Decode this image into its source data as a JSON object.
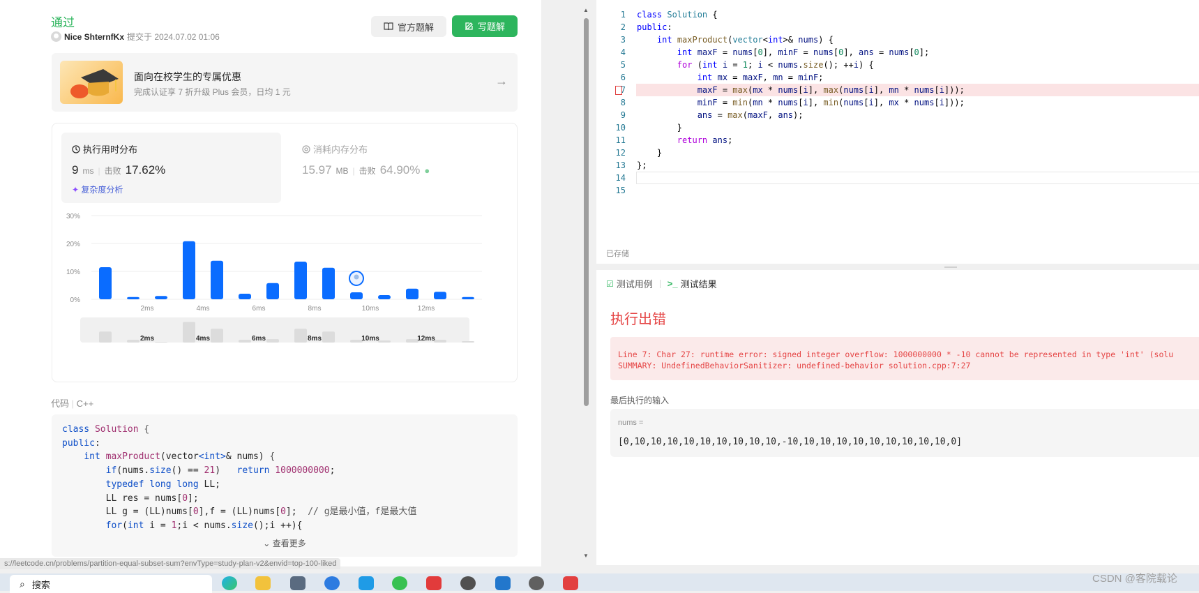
{
  "submission": {
    "status": "通过",
    "user": "Nice ShternfKx",
    "submitted_at": "提交于 2024.07.02 01:06",
    "official_btn": "官方题解",
    "write_btn": "写题解"
  },
  "promo": {
    "title": "面向在校学生的专属优惠",
    "subtitle": "完成认证享 7 折升级 Plus 会员，日均 1 元",
    "arrow": "→"
  },
  "runtime": {
    "title": "执行用时分布",
    "value": "9",
    "unit": "ms",
    "beat_label": "击败",
    "beat_pct": "17.62%",
    "complexity_link": "复杂度分析"
  },
  "memory": {
    "title": "消耗内存分布",
    "value": "15.97",
    "unit": "MB",
    "beat_label": "击败",
    "beat_pct": "64.90%"
  },
  "chart_data": {
    "type": "bar",
    "title": "",
    "xlabel": "",
    "ylabel": "",
    "ylim": [
      0,
      30
    ],
    "y_ticks": [
      "30%",
      "20%",
      "10%",
      "0%"
    ],
    "x_tick_labels": [
      "2ms",
      "4ms",
      "6ms",
      "8ms",
      "10ms",
      "12ms"
    ],
    "values": [
      11.5,
      0.8,
      1.2,
      20.8,
      13.8,
      2.0,
      5.8,
      13.5,
      11.3,
      2.5,
      1.5,
      3.8,
      2.7,
      0.8
    ],
    "overview_values": [
      3.2,
      0.8,
      0.2,
      6.0,
      4.0,
      0.8,
      1.0,
      4.0,
      3.2,
      0.8,
      0.6,
      1.0,
      0.8,
      0.4
    ],
    "current_index": 9,
    "color": "#0a6cff"
  },
  "code_section": {
    "label": "代码",
    "lang": "C++",
    "lines": [
      "class Solution {",
      "public:",
      "    int maxProduct(vector<int>& nums) {",
      "        if(nums.size() == 21)   return 1000000000;",
      "        typedef long long LL;",
      "        LL res = nums[0];",
      "        LL g = (LL)nums[0],f = (LL)nums[0];  // g是最小值，f是最大值",
      "        for(int i = 1;i < nums.size();i ++){"
    ],
    "see_more": "查看更多"
  },
  "status_url": "s://leetcode.cn/problems/partition-equal-subset-sum?envType=study-plan-v2&envid=top-100-liked",
  "editor": {
    "lines": [
      "class Solution {",
      "public:",
      "    int maxProduct(vector<int>& nums) {",
      "        int maxF = nums[0], minF = nums[0], ans = nums[0];",
      "        for (int i = 1; i < nums.size(); ++i) {",
      "            int mx = maxF, mn = minF;",
      "            maxF = max(mx * nums[i], max(nums[i], mn * nums[i]));",
      "            minF = min(mn * nums[i], min(nums[i], mx * nums[i]));",
      "            ans = max(maxF, ans);",
      "        }",
      "        return ans;",
      "    }",
      "};",
      "",
      ""
    ],
    "saved": "已存储"
  },
  "result": {
    "tab_testcase": "测试用例",
    "tab_result": "测试结果",
    "error_title": "执行出错",
    "error_line1": "Line 7: Char 27: runtime error: signed integer overflow: 1000000000 * -10 cannot be represented in type 'int' (solu",
    "error_line2": "SUMMARY: UndefinedBehaviorSanitizer: undefined-behavior solution.cpp:7:27",
    "last_input_label": "最后执行的输入",
    "input_name": "nums =",
    "input_value": "[0,10,10,10,10,10,10,10,10,10,-10,10,10,10,10,10,10,10,10,10,0]"
  },
  "taskbar": {
    "search": "搜索",
    "watermark": "CSDN @客院载论"
  }
}
